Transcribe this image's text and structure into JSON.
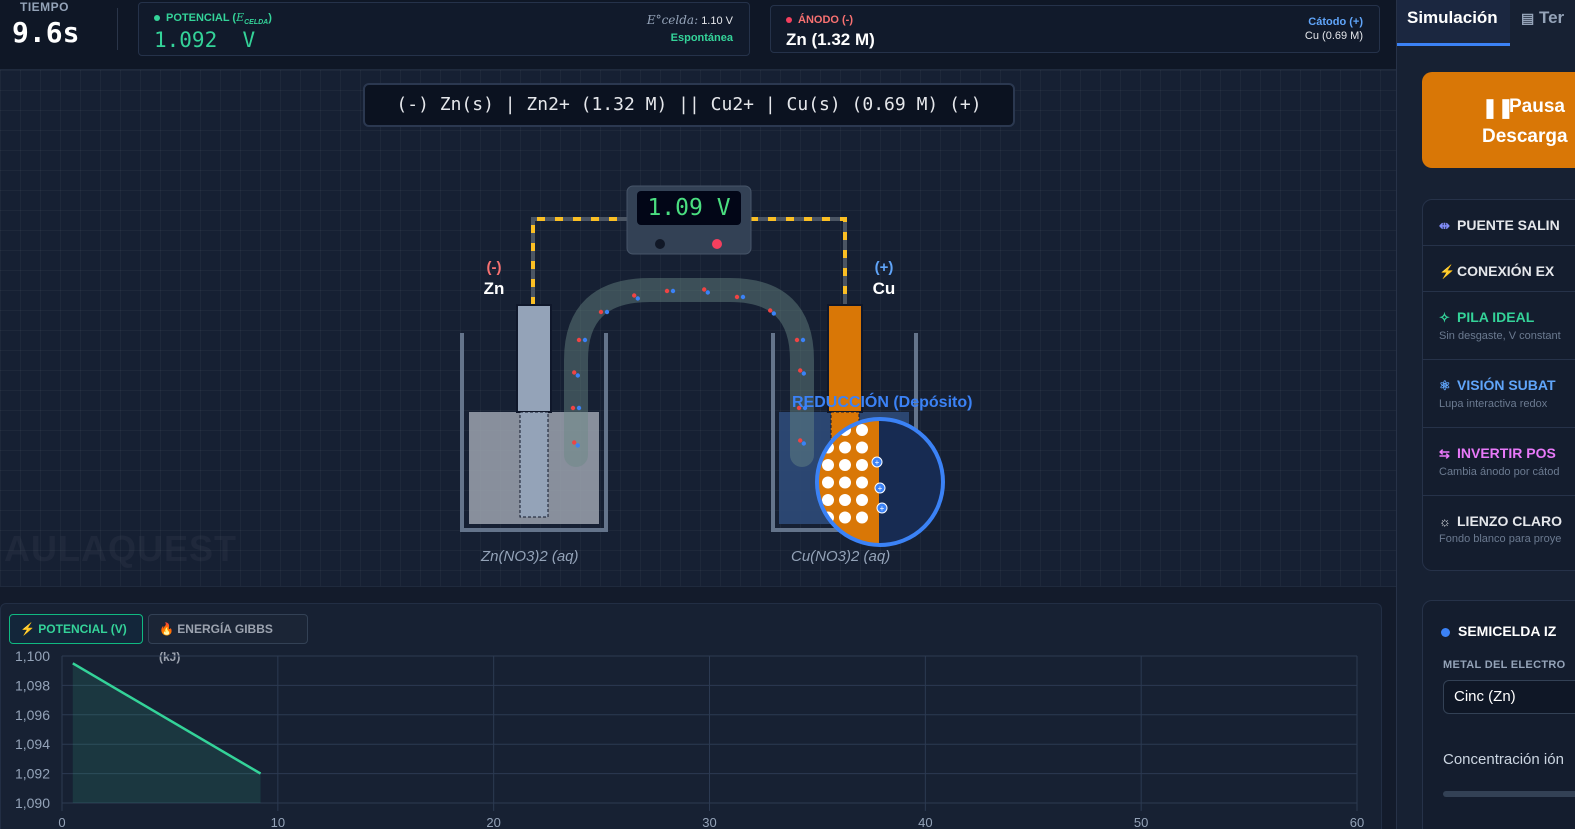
{
  "header": {
    "time_label": "TIEMPO",
    "time_value": "9.6s",
    "potential_label": "POTENCIAL (",
    "potential_symbol": "E",
    "potential_sub": "CELDA",
    "potential_close": ")",
    "potential_value": "1.092  V",
    "ecell_symbol": "E°celda:",
    "ecell_value": "1.10 V",
    "spontaneity": "Espontánea",
    "anode_label": "ÁNODO (-)",
    "anode_value": "Zn (1.32 M)",
    "cathode_label": "Cátodo (+)",
    "cathode_value": "Cu (0.69 M)"
  },
  "cell": {
    "notation": "(-) Zn(s) | Zn2+ (1.32 M) || Cu2+ | Cu(s) (0.69 M) (+)",
    "voltmeter_value": "1.09 V",
    "left_sign": "(-)",
    "left_metal": "Zn",
    "right_sign": "(+)",
    "right_metal": "Cu",
    "left_solution": "Zn(NO3)2 (aq)",
    "right_solution": "Cu(NO3)2 (aq)",
    "reduction_label": "REDUCCIÓN (Depósito)",
    "watermark": "AULAQUEST",
    "colors": {
      "anode": "#94a3b8",
      "cathode": "#d97706",
      "wire": "#fbbf24",
      "accent": "#3b82f6"
    }
  },
  "chart_tabs": {
    "potential": "POTENCIAL (V)",
    "gibbs": "ENERGÍA GIBBS (kJ)"
  },
  "chart_data": {
    "type": "area",
    "series": [
      {
        "x": [
          0.5,
          9.2
        ],
        "y": [
          1.0995,
          1.092
        ]
      }
    ],
    "yticks": [
      "1,100",
      "1,098",
      "1,096",
      "1,094",
      "1,092",
      "1,090"
    ],
    "xticks": [
      "0",
      "10",
      "20",
      "30",
      "40",
      "50",
      "60"
    ],
    "ylim": [
      1.09,
      1.1
    ],
    "xlim": [
      0,
      60
    ],
    "grid": true,
    "color": "#34d399"
  },
  "sidebar": {
    "tab_sim": "Simulación",
    "tab_ter": "Ter",
    "pause_line1": "Pausa",
    "pause_line2": "Descarga",
    "options": [
      {
        "icon": "bridge-icon",
        "title": "PUENTE SALIN",
        "desc": "",
        "color": "#e5e7eb",
        "icon_color": "#818cf8"
      },
      {
        "icon": "plug-icon",
        "title": "CONEXIÓN EX",
        "desc": "",
        "color": "#e5e7eb",
        "icon_color": "#fbbf24"
      },
      {
        "icon": "wand-icon",
        "title": "PILA IDEAL",
        "desc": "Sin desgaste, V constant",
        "color": "#34d399",
        "icon_color": "#34d399"
      },
      {
        "icon": "atom-icon",
        "title": "VISIÓN SUBAT",
        "desc": "Lupa interactiva redox",
        "color": "#60a5fa",
        "icon_color": "#60a5fa"
      },
      {
        "icon": "swap-icon",
        "title": "INVERTIR POS",
        "desc": "Cambia ánodo por cátod",
        "color": "#e879f9",
        "icon_color": "#e879f9"
      },
      {
        "icon": "sun-icon",
        "title": "LIENZO CLARO",
        "desc": "Fondo blanco para proye",
        "color": "#e5e7eb",
        "icon_color": "#e5e7eb"
      }
    ],
    "semicell_title": "SEMICELDA IZ",
    "metal_label": "METAL DEL ELECTRO",
    "metal_value": "Cinc (Zn)",
    "conc_label": "Concentración ión"
  }
}
